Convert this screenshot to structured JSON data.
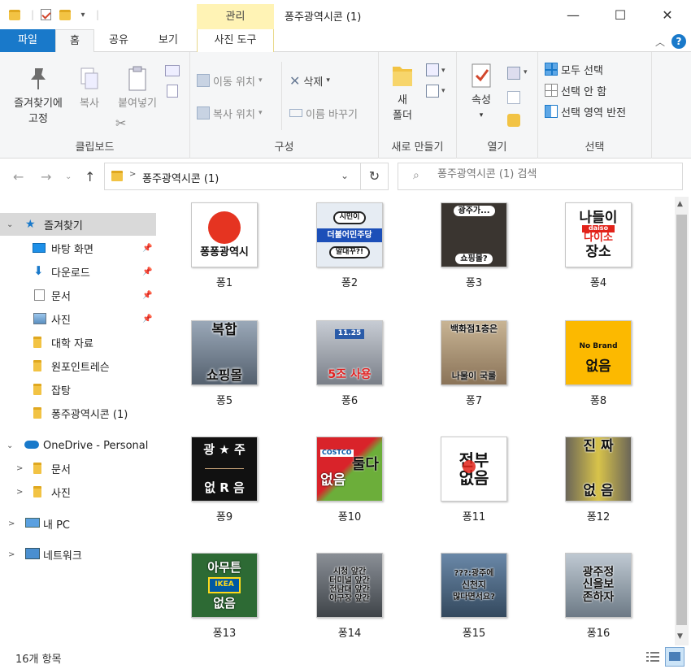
{
  "window": {
    "title": "퐁주광역시콘 (1)",
    "contextual_tab_group": "관리",
    "minimize_glyph": "—",
    "maximize_glyph": "☐",
    "close_glyph": "✕"
  },
  "ribbon_tabs": {
    "file": "파일",
    "home": "홈",
    "share": "공유",
    "view": "보기",
    "picture_tools": "사진 도구"
  },
  "ribbon": {
    "clipboard": {
      "label": "클립보드",
      "pin": "즐겨찾기에\n고정",
      "pin_line1": "즐겨찾기에",
      "pin_line2": "고정",
      "copy": "복사",
      "paste": "붙여넣기"
    },
    "organize": {
      "label": "구성",
      "move_to": "이동 위치",
      "copy_to": "복사 위치",
      "delete": "삭제",
      "rename": "이름 바꾸기"
    },
    "new": {
      "label": "새로 만들기",
      "new_folder_line1": "새",
      "new_folder_line2": "폴더"
    },
    "open": {
      "label": "열기",
      "properties": "속성"
    },
    "select": {
      "label": "선택",
      "select_all": "모두 선택",
      "select_none": "선택 안 함",
      "invert": "선택 영역 반전"
    }
  },
  "address": {
    "path": "퐁주광역시콘 (1)",
    "search_placeholder": "퐁주광역시콘 (1) 검색"
  },
  "nav": {
    "quick_access": "즐겨찾기",
    "desktop": "바탕 화면",
    "downloads": "다운로드",
    "documents": "문서",
    "pictures": "사진",
    "folder1": "대학 자료",
    "folder2": "원포인트레슨",
    "folder3": "잡탕",
    "folder4": "퐁주광역시콘 (1)",
    "onedrive": "OneDrive - Personal",
    "od_documents": "문서",
    "od_pictures": "사진",
    "this_pc": "내 PC",
    "network": "네트워크"
  },
  "files": [
    {
      "name": "퐁1",
      "text": "퐁퐁광역시",
      "text2": ""
    },
    {
      "name": "퐁2",
      "text": "시민이",
      "text2": "더불어민주당",
      "text3": "알대꾸?!"
    },
    {
      "name": "퐁3",
      "text": "광주가...",
      "text2": "쇼핑몰?"
    },
    {
      "name": "퐁4",
      "text": "나들이",
      "text2": "daiso",
      "text3": "다이소",
      "text4": "장소"
    },
    {
      "name": "퐁5",
      "text": "복합",
      "text2": "쇼핑몰"
    },
    {
      "name": "퐁6",
      "text": "11.25",
      "text2": "5조 사용"
    },
    {
      "name": "퐁7",
      "text": "백화점1층은",
      "text2": "나물이 국룰"
    },
    {
      "name": "퐁8",
      "text": "No Brand",
      "text2": "없음"
    },
    {
      "name": "퐁9",
      "text": "광 ★ 주",
      "text2": "없 R 음"
    },
    {
      "name": "퐁10",
      "text": "COSTCO",
      "text2": "둘다",
      "text3": "없음"
    },
    {
      "name": "퐁11",
      "text": "전부",
      "text2": "없음"
    },
    {
      "name": "퐁12",
      "text": "진 짜",
      "text2": "없 음"
    },
    {
      "name": "퐁13",
      "text": "아무튼",
      "text2": "IKEA",
      "text3": "없음"
    },
    {
      "name": "퐁14",
      "text": "시청 앞간",
      "text2": "터미널 앞간",
      "text3": "전남대 앞간",
      "text4": "야구장 앞간"
    },
    {
      "name": "퐁15",
      "text": "???:광주에",
      "text2": "신천지",
      "text3": "많다면서요?"
    },
    {
      "name": "퐁16",
      "text": "광주정",
      "text2": "신을보",
      "text3": "존하자"
    }
  ],
  "status": {
    "count": "16개 항목"
  },
  "colors": {
    "accent": "#1979ca",
    "contextual_tab": "#fff3b5",
    "selection": "#cce8ff"
  }
}
